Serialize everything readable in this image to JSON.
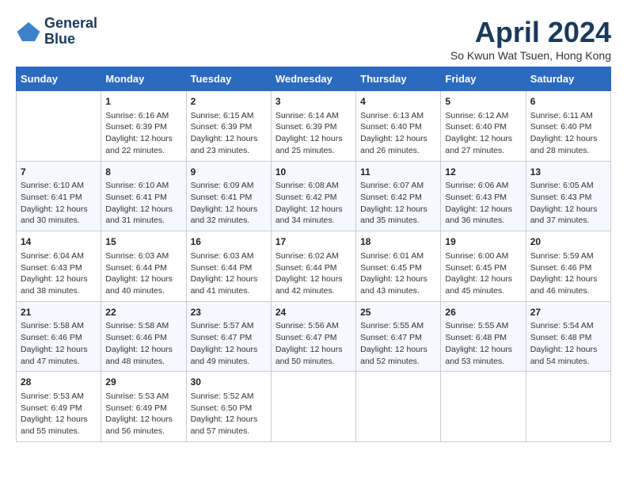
{
  "header": {
    "logo_line1": "General",
    "logo_line2": "Blue",
    "month_title": "April 2024",
    "subtitle": "So Kwun Wat Tsuen, Hong Kong"
  },
  "weekdays": [
    "Sunday",
    "Monday",
    "Tuesday",
    "Wednesday",
    "Thursday",
    "Friday",
    "Saturday"
  ],
  "weeks": [
    [
      {
        "day": "",
        "info": ""
      },
      {
        "day": "1",
        "info": "Sunrise: 6:16 AM\nSunset: 6:39 PM\nDaylight: 12 hours\nand 22 minutes."
      },
      {
        "day": "2",
        "info": "Sunrise: 6:15 AM\nSunset: 6:39 PM\nDaylight: 12 hours\nand 23 minutes."
      },
      {
        "day": "3",
        "info": "Sunrise: 6:14 AM\nSunset: 6:39 PM\nDaylight: 12 hours\nand 25 minutes."
      },
      {
        "day": "4",
        "info": "Sunrise: 6:13 AM\nSunset: 6:40 PM\nDaylight: 12 hours\nand 26 minutes."
      },
      {
        "day": "5",
        "info": "Sunrise: 6:12 AM\nSunset: 6:40 PM\nDaylight: 12 hours\nand 27 minutes."
      },
      {
        "day": "6",
        "info": "Sunrise: 6:11 AM\nSunset: 6:40 PM\nDaylight: 12 hours\nand 28 minutes."
      }
    ],
    [
      {
        "day": "7",
        "info": "Sunrise: 6:10 AM\nSunset: 6:41 PM\nDaylight: 12 hours\nand 30 minutes."
      },
      {
        "day": "8",
        "info": "Sunrise: 6:10 AM\nSunset: 6:41 PM\nDaylight: 12 hours\nand 31 minutes."
      },
      {
        "day": "9",
        "info": "Sunrise: 6:09 AM\nSunset: 6:41 PM\nDaylight: 12 hours\nand 32 minutes."
      },
      {
        "day": "10",
        "info": "Sunrise: 6:08 AM\nSunset: 6:42 PM\nDaylight: 12 hours\nand 34 minutes."
      },
      {
        "day": "11",
        "info": "Sunrise: 6:07 AM\nSunset: 6:42 PM\nDaylight: 12 hours\nand 35 minutes."
      },
      {
        "day": "12",
        "info": "Sunrise: 6:06 AM\nSunset: 6:43 PM\nDaylight: 12 hours\nand 36 minutes."
      },
      {
        "day": "13",
        "info": "Sunrise: 6:05 AM\nSunset: 6:43 PM\nDaylight: 12 hours\nand 37 minutes."
      }
    ],
    [
      {
        "day": "14",
        "info": "Sunrise: 6:04 AM\nSunset: 6:43 PM\nDaylight: 12 hours\nand 38 minutes."
      },
      {
        "day": "15",
        "info": "Sunrise: 6:03 AM\nSunset: 6:44 PM\nDaylight: 12 hours\nand 40 minutes."
      },
      {
        "day": "16",
        "info": "Sunrise: 6:03 AM\nSunset: 6:44 PM\nDaylight: 12 hours\nand 41 minutes."
      },
      {
        "day": "17",
        "info": "Sunrise: 6:02 AM\nSunset: 6:44 PM\nDaylight: 12 hours\nand 42 minutes."
      },
      {
        "day": "18",
        "info": "Sunrise: 6:01 AM\nSunset: 6:45 PM\nDaylight: 12 hours\nand 43 minutes."
      },
      {
        "day": "19",
        "info": "Sunrise: 6:00 AM\nSunset: 6:45 PM\nDaylight: 12 hours\nand 45 minutes."
      },
      {
        "day": "20",
        "info": "Sunrise: 5:59 AM\nSunset: 6:46 PM\nDaylight: 12 hours\nand 46 minutes."
      }
    ],
    [
      {
        "day": "21",
        "info": "Sunrise: 5:58 AM\nSunset: 6:46 PM\nDaylight: 12 hours\nand 47 minutes."
      },
      {
        "day": "22",
        "info": "Sunrise: 5:58 AM\nSunset: 6:46 PM\nDaylight: 12 hours\nand 48 minutes."
      },
      {
        "day": "23",
        "info": "Sunrise: 5:57 AM\nSunset: 6:47 PM\nDaylight: 12 hours\nand 49 minutes."
      },
      {
        "day": "24",
        "info": "Sunrise: 5:56 AM\nSunset: 6:47 PM\nDaylight: 12 hours\nand 50 minutes."
      },
      {
        "day": "25",
        "info": "Sunrise: 5:55 AM\nSunset: 6:47 PM\nDaylight: 12 hours\nand 52 minutes."
      },
      {
        "day": "26",
        "info": "Sunrise: 5:55 AM\nSunset: 6:48 PM\nDaylight: 12 hours\nand 53 minutes."
      },
      {
        "day": "27",
        "info": "Sunrise: 5:54 AM\nSunset: 6:48 PM\nDaylight: 12 hours\nand 54 minutes."
      }
    ],
    [
      {
        "day": "28",
        "info": "Sunrise: 5:53 AM\nSunset: 6:49 PM\nDaylight: 12 hours\nand 55 minutes."
      },
      {
        "day": "29",
        "info": "Sunrise: 5:53 AM\nSunset: 6:49 PM\nDaylight: 12 hours\nand 56 minutes."
      },
      {
        "day": "30",
        "info": "Sunrise: 5:52 AM\nSunset: 6:50 PM\nDaylight: 12 hours\nand 57 minutes."
      },
      {
        "day": "",
        "info": ""
      },
      {
        "day": "",
        "info": ""
      },
      {
        "day": "",
        "info": ""
      },
      {
        "day": "",
        "info": ""
      }
    ]
  ]
}
